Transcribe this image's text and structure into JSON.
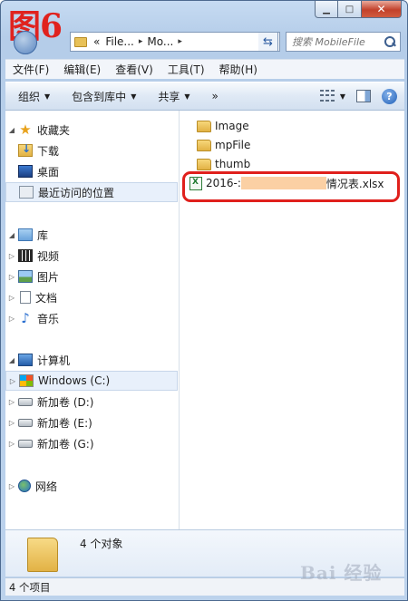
{
  "figure_label": "图6",
  "address": {
    "prefix": "«",
    "crumbs": [
      "File...",
      "Mo..."
    ],
    "sep": "▸"
  },
  "search": {
    "placeholder": "搜索 MobileFile"
  },
  "menu": [
    "文件(F)",
    "编辑(E)",
    "查看(V)",
    "工具(T)",
    "帮助(H)"
  ],
  "toolbar": {
    "organize": "组织",
    "include_in_library": "包含到库中",
    "share": "共享",
    "more": "»"
  },
  "nav": {
    "favorites": "收藏夹",
    "downloads": "下载",
    "desktop": "桌面",
    "recent": "最近访问的位置",
    "libraries": "库",
    "videos": "视频",
    "pictures": "图片",
    "documents": "文档",
    "music": "音乐",
    "computer": "计算机",
    "drive_c": "Windows  (C:)",
    "drive_d": "新加卷 (D:)",
    "drive_e": "新加卷 (E:)",
    "drive_g": "新加卷 (G:)",
    "network": "网络"
  },
  "files": [
    {
      "name": "Image",
      "type": "folder"
    },
    {
      "name": "mpFile",
      "type": "folder"
    },
    {
      "name": "thumb",
      "type": "folder"
    }
  ],
  "highlighted_file": {
    "prefix": "2016-:",
    "suffix": "情况表.xlsx"
  },
  "details": {
    "count": "4 个对象"
  },
  "status": {
    "items": "4 个项目"
  },
  "watermark": "Bai 经验"
}
